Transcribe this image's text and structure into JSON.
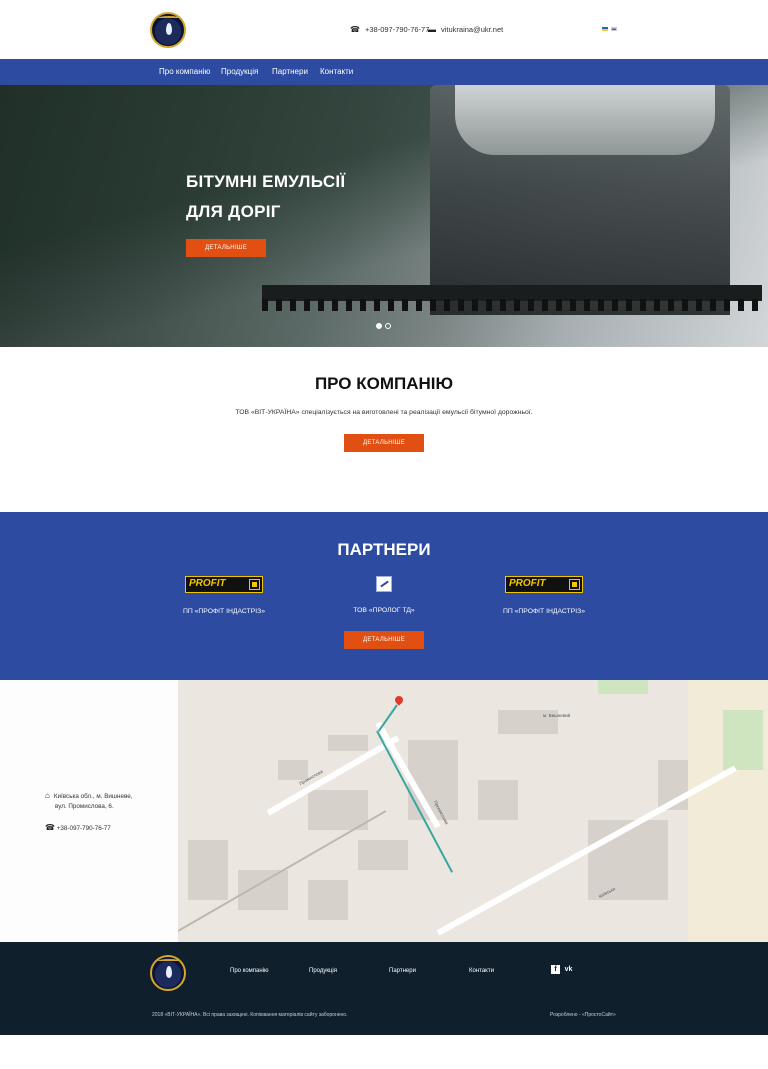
{
  "header": {
    "phone": "+38-097-790-76-77",
    "email": "vitukraina@ukr.net",
    "languages": [
      "ua",
      "ru"
    ],
    "logo_icon": "company-logo"
  },
  "nav": {
    "items": [
      {
        "label": "Про компанію"
      },
      {
        "label": "Продукція"
      },
      {
        "label": "Партнери"
      },
      {
        "label": "Контакти"
      }
    ]
  },
  "hero": {
    "title_line1": "БІТУМНІ ЕМУЛЬСІЇ",
    "title_line2": "ДЛЯ ДОРІГ",
    "button_label": "ДЕТАЛЬНІШЕ",
    "slides": 2,
    "active_slide": 1
  },
  "about": {
    "title": "ПРО КОМПАНІЮ",
    "text": "ТОВ «ВІТ-УКРАЇНА» спеціалізується на виготовлені та реалізації емульсії бітумної дорожньої.",
    "button_label": "ДЕТАЛЬНІШЕ"
  },
  "partners": {
    "title": "ПАРТНЕРИ",
    "items": [
      {
        "name": "ПП «ПРОФІТ ІНДАСТРІЗ»",
        "logo_text": "PROFIT"
      },
      {
        "name": "ТОВ «ПРОЛОГ ТД»",
        "logo_text": ""
      },
      {
        "name": "ПП «ПРОФІТ ІНДАСТРІЗ»",
        "logo_text": "PROFIT"
      }
    ],
    "button_label": "ДЕТАЛЬНІШЕ"
  },
  "contacts": {
    "address_line1": "Київська обл., м. Вишневе,",
    "address_line2": "вул. Промислова, 6.",
    "phone": "+38-097-790-76-77"
  },
  "map": {
    "labels": [
      "Промислова",
      "Київська",
      "м. Вишневий",
      "Промислова"
    ]
  },
  "footer": {
    "nav": [
      "Про компанію",
      "Продукція",
      "Партнери",
      "Контакти"
    ],
    "social": [
      "f",
      "vk"
    ],
    "copyright": "2018 «ВІТ-УКРАЇНА». Всі права захищені. Копіювання матеріалів сайту заборонено.",
    "developer": "Розроблено - «ПростоСайт»"
  }
}
